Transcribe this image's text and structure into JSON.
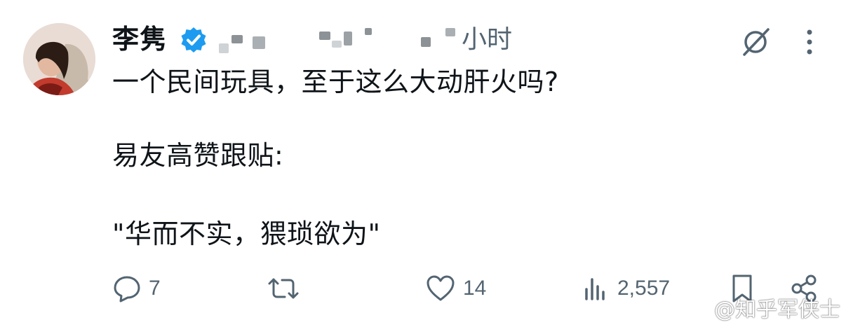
{
  "post": {
    "author_name": "李隽",
    "time_ago": "小时",
    "lines": [
      "一个民间玩具，至于这么大动肝火吗?",
      "易友高赞跟贴:",
      "\"华而不实，猥琐欲为\""
    ]
  },
  "actions": {
    "reply_count": "7",
    "repost_count": "",
    "like_count": "14",
    "views_count": "2,557"
  },
  "watermark": "@知乎军侠士",
  "icons": {
    "verified": "verified-badge-icon",
    "grok": "grok-icon",
    "more": "more-vertical-icon",
    "reply": "reply-icon",
    "repost": "repost-icon",
    "like": "heart-icon",
    "views": "views-chart-icon",
    "bookmark": "bookmark-icon",
    "share": "share-icon"
  },
  "colors": {
    "verified": "#1d9bf0",
    "text": "#0f1419",
    "muted": "#536471"
  }
}
